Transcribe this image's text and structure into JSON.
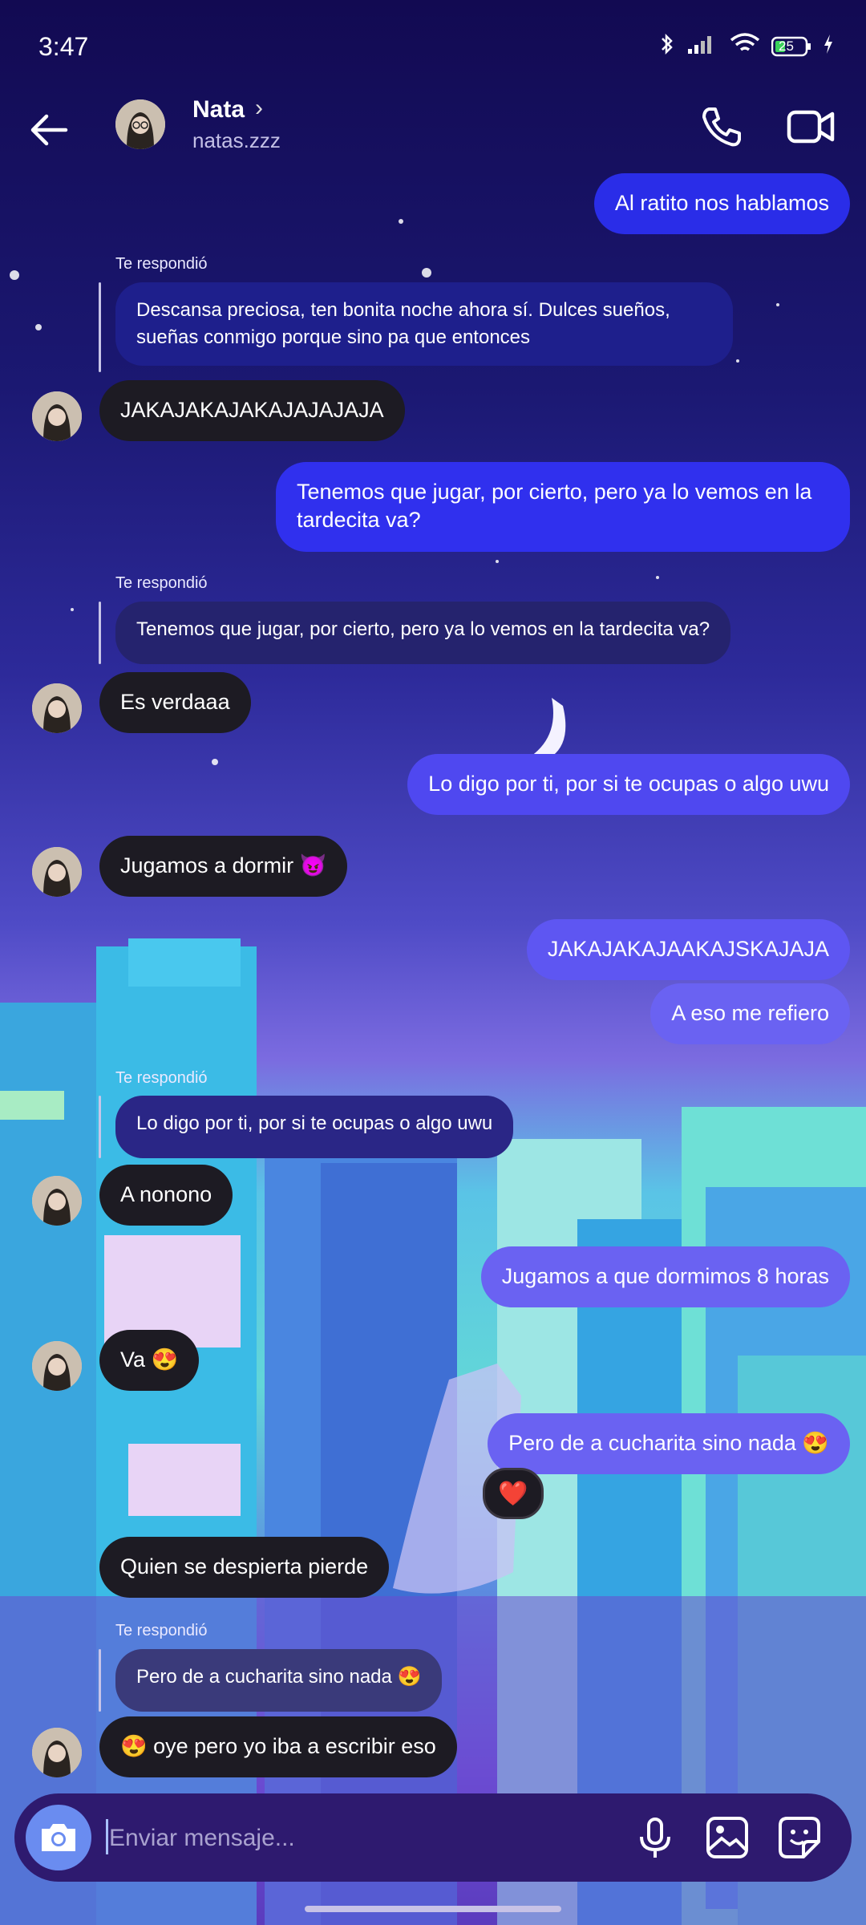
{
  "status": {
    "time": "3:47",
    "battery": "25"
  },
  "header": {
    "name": "Nata",
    "chevron": "›",
    "handle": "natas.zzz"
  },
  "reply_label": "Te respondió",
  "messages": {
    "m1": "Al ratito nos hablamos",
    "r1": "Descansa preciosa, ten bonita noche ahora sí. Dulces sueños, sueñas conmigo porque sino pa que entonces",
    "m2": "JAKAJAKAJAKAJAJAJAJA",
    "m3": "Tenemos que jugar, por cierto, pero ya lo vemos en la tardecita va?",
    "r2": "Tenemos que jugar, por cierto, pero ya lo vemos en la tardecita va?",
    "m4": "Es verdaaa",
    "m5": "Lo digo por ti, por si te ocupas o algo uwu",
    "m6": "Jugamos a dormir 😈",
    "m7": "JAKAJAKAJAAKAJSKAJAJA",
    "m8": "A eso me refiero",
    "r3": "Lo digo por ti, por si te ocupas o algo uwu",
    "m9": "A nonono",
    "m10": "Jugamos a que dormimos 8 horas",
    "m11": "Va 😍",
    "m12": "Pero de a cucharita sino nada 😍",
    "reaction": "❤️",
    "m13": "Quien se despierta pierde",
    "r4": "Pero de a cucharita sino nada 😍",
    "m14": "😍 oye pero yo iba a escribir eso"
  },
  "composer": {
    "placeholder": "Enviar mensaje..."
  },
  "colors": {
    "outgoing_dark": "#2a2de8",
    "outgoing_light": "#6a62f2",
    "incoming": "#1d1b23"
  },
  "icons": [
    "back-arrow-icon",
    "chevron-right-icon",
    "phone-icon",
    "video-icon",
    "camera-icon",
    "microphone-icon",
    "gallery-icon",
    "sticker-icon",
    "bluetooth-icon",
    "signal-icon",
    "wifi-icon",
    "battery-icon"
  ]
}
